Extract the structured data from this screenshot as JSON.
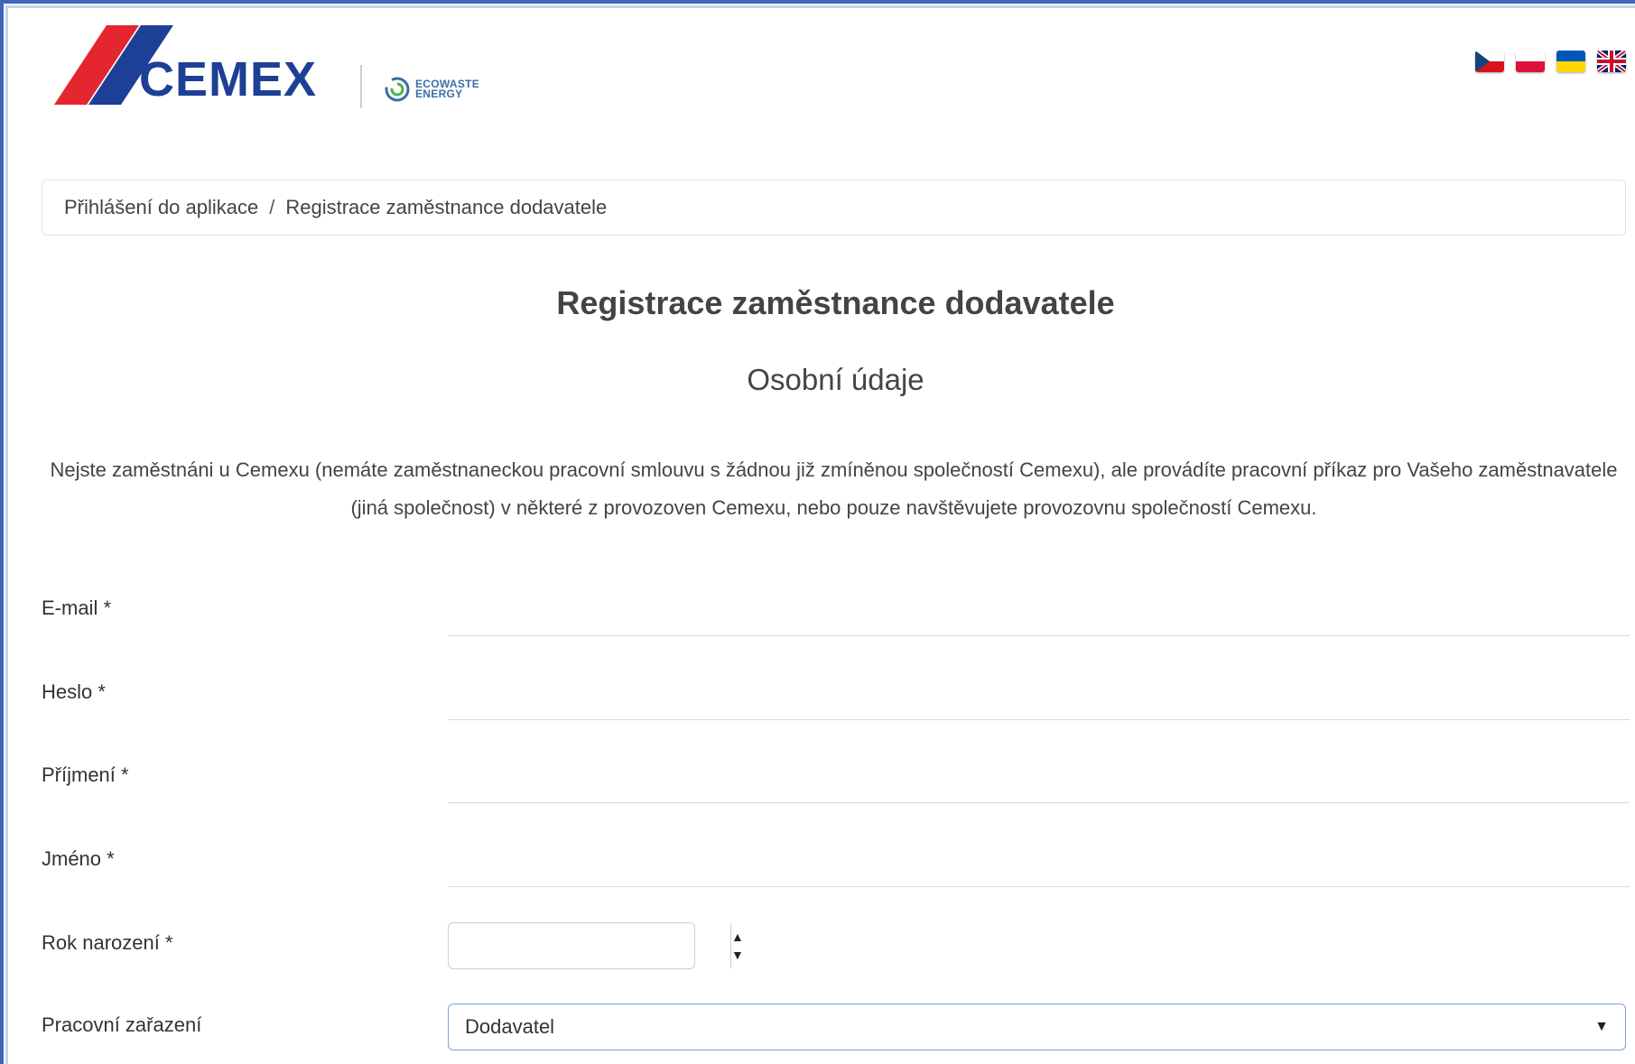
{
  "brand": {
    "logo_alt": "CEMEX",
    "sub_logo_line1": "ECOWASTE",
    "sub_logo_line2": "ENERGY"
  },
  "languages": [
    {
      "code": "cs",
      "icon": "flag-cz-icon"
    },
    {
      "code": "pl",
      "icon": "flag-pl-icon"
    },
    {
      "code": "uk",
      "icon": "flag-ua-icon"
    },
    {
      "code": "en",
      "icon": "flag-gb-icon"
    }
  ],
  "breadcrumb": {
    "items": [
      "Přihlášení do aplikace",
      "Registrace zaměstnance dodavatele"
    ],
    "separator": "/"
  },
  "page": {
    "title": "Registrace zaměstnance dodavatele",
    "subtitle": "Osobní údaje",
    "description": "Nejste zaměstnáni u Cemexu (nemáte zaměstnaneckou pracovní smlouvu s žádnou již zmíněnou společností Cemexu), ale provádíte pracovní příkaz pro Vašeho zaměstnavatele (jiná společnost) v některé z provozoven Cemexu, nebo pouze navštěvujete provozovnu společností Cemexu."
  },
  "form": {
    "email_label": "E-mail *",
    "email_value": "",
    "password_label": "Heslo *",
    "password_value": "",
    "surname_label": "Příjmení *",
    "surname_value": "",
    "firstname_label": "Jméno *",
    "firstname_value": "",
    "birth_year_label": "Rok narození *",
    "birth_year_value": "",
    "job_label": "Pracovní zařazení",
    "job_value": "Dodavatel"
  },
  "colors": {
    "frame_accent": "#3e67b8",
    "logo_red": "#e3262f",
    "logo_blue": "#1d3f95",
    "focus_border": "#7fa3d6"
  }
}
